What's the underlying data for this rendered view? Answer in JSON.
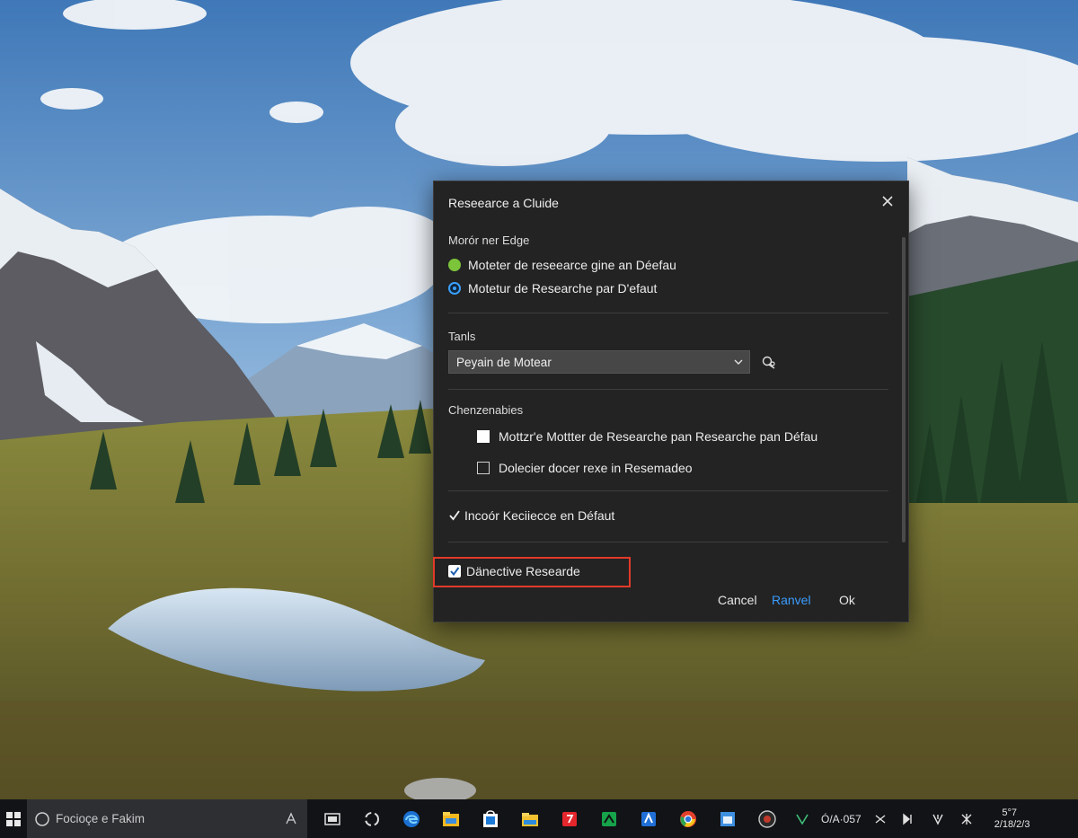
{
  "dialog": {
    "title": "Reseearce a Cluide",
    "section1_label": "Morór ner Edge",
    "radio1_label": "Moteter de reseearce gine an Déefau",
    "radio2_label": "Motetur de Researche par D'efaut",
    "section2_label": "Tanls",
    "select_value": "Peyain de Motear",
    "section3_label": "Chenzenabies",
    "checkbox1_label": "Mottzr'e Mottter de Researche pan Researche pan Défau",
    "checkbox2_label": "Dolecier docer rexe in Resemadeo",
    "checkbox3_label": "Incoór Keciiecce en Défaut",
    "checkbox4_label": "Dänective Researde",
    "buttons": {
      "cancel": "Cancel",
      "ranvel": "Ranvel",
      "ok": "Ok"
    }
  },
  "taskbar": {
    "search_placeholder": "Focioçe e Fakim",
    "tray_text": "Ó/A·057",
    "clock_line1": "5°7",
    "clock_line2": "2/18/2/3"
  },
  "colors": {
    "dialog_bg": "#232323",
    "accent_blue": "#3a9cff",
    "highlight_red": "#e23a2a",
    "radio_green": "#7cc43a",
    "taskbar_bg": "#111316"
  },
  "icons": [
    "windows-start-icon",
    "search-icon",
    "microphone-icon",
    "task-view-icon",
    "cortana-icon",
    "edge-icon",
    "file-explorer-icon",
    "store-icon",
    "folder-icon",
    "red-app-icon",
    "green-app-icon",
    "blue-app-icon",
    "chrome-icon",
    "calendar-icon",
    "media-icon",
    "network-icon",
    "volume-icon"
  ]
}
